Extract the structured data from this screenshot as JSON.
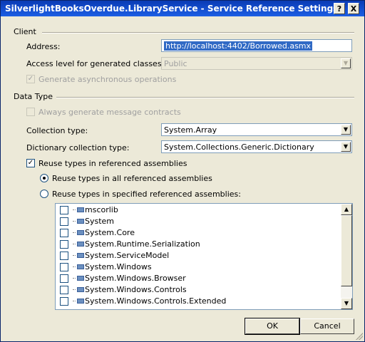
{
  "window": {
    "title": "SilverlightBooksOverdue.LibraryService - Service Reference Settings",
    "help_label": "?",
    "close_label": "X"
  },
  "client": {
    "section_label": "Client",
    "address_label": "Address:",
    "address_value": "http://localhost:4402/Borrowed.asmx",
    "access_label": "Access level for generated classes:",
    "access_value": "Public",
    "async_label": "Generate asynchronous operations",
    "async_checked": true
  },
  "data_type": {
    "section_label": "Data Type",
    "message_contracts_label": "Always generate message contracts",
    "collection_label": "Collection type:",
    "collection_value": "System.Array",
    "dictionary_label": "Dictionary collection type:",
    "dictionary_value": "System.Collections.Generic.Dictionary",
    "reuse_label": "Reuse types in referenced assemblies",
    "reuse_checked": true,
    "reuse_all_label": "Reuse types in all referenced assemblies",
    "reuse_specified_label": "Reuse types in specified referenced assemblies:",
    "assemblies": [
      "mscorlib",
      "System",
      "System.Core",
      "System.Runtime.Serialization",
      "System.ServiceModel",
      "System.Windows",
      "System.Windows.Browser",
      "System.Windows.Controls",
      "System.Windows.Controls.Extended"
    ]
  },
  "buttons": {
    "ok": "OK",
    "cancel": "Cancel"
  },
  "colors": {
    "title_bar": "#0a3bb5",
    "dialog_bg": "#ece9d8",
    "selection": "#316ac5"
  }
}
